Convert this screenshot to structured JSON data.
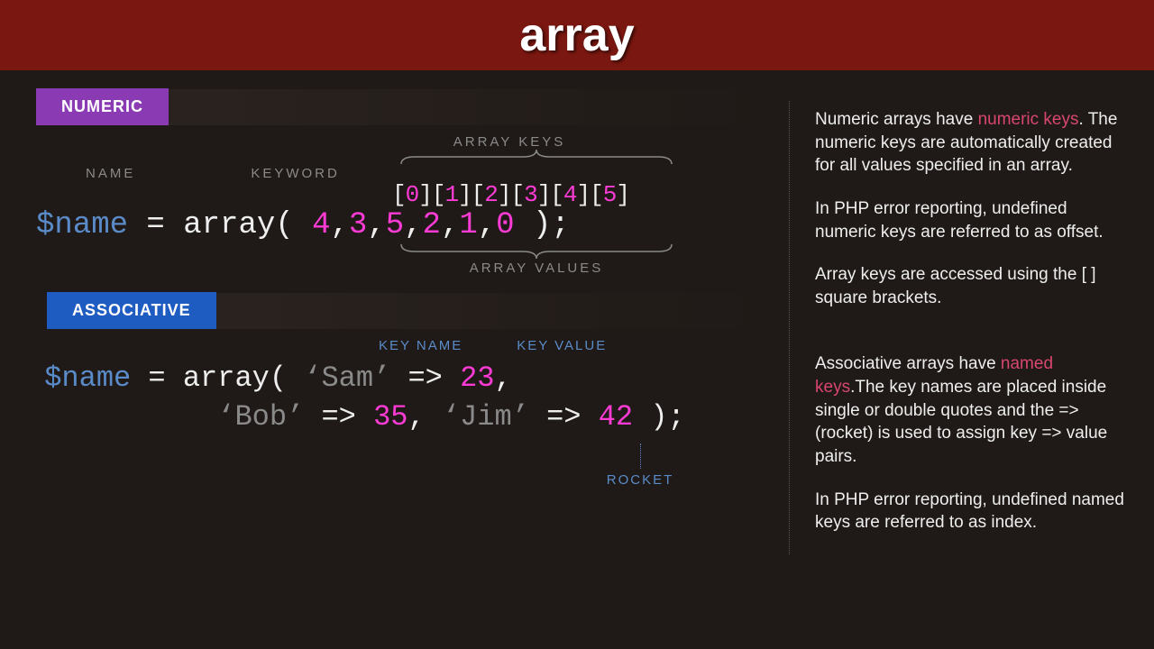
{
  "header": {
    "title": "array"
  },
  "tabs": {
    "numeric": "NUMERIC",
    "associative": "ASSOCIATIVE"
  },
  "labels": {
    "name": "NAME",
    "keyword": "KEYWORD",
    "array_keys": "ARRAY KEYS",
    "array_values": "ARRAY VALUES",
    "key_name": "KEY NAME",
    "key_value": "KEY VALUE",
    "rocket": "ROCKET"
  },
  "numeric": {
    "variable": "$name",
    "keyword": "array",
    "indices": [
      "0",
      "1",
      "2",
      "3",
      "4",
      "5"
    ],
    "values": [
      "4",
      "3",
      "5",
      "2",
      "1",
      "0"
    ]
  },
  "associative": {
    "variable": "$name",
    "keyword": "array",
    "pairs": [
      {
        "key": "Sam",
        "value": "23"
      },
      {
        "key": "Bob",
        "value": "35"
      },
      {
        "key": "Jim",
        "value": "42"
      }
    ]
  },
  "desc": {
    "p1a": "Numeric arrays have ",
    "p1b": "numeric keys",
    "p1c": ". The numeric keys are automatically created for all values specified in an array.",
    "p2": "In PHP error reporting, undefined numeric keys are referred to as offset.",
    "p3": "Array keys are accessed using the [  ] square brackets.",
    "p4a": "Associative arrays have ",
    "p4b": "named keys",
    "p4c": ".The key names are placed inside single or double quotes and the => (rocket) is used to assign key => value pairs.",
    "p5": "In PHP error reporting, undefined named keys are referred to as index."
  }
}
